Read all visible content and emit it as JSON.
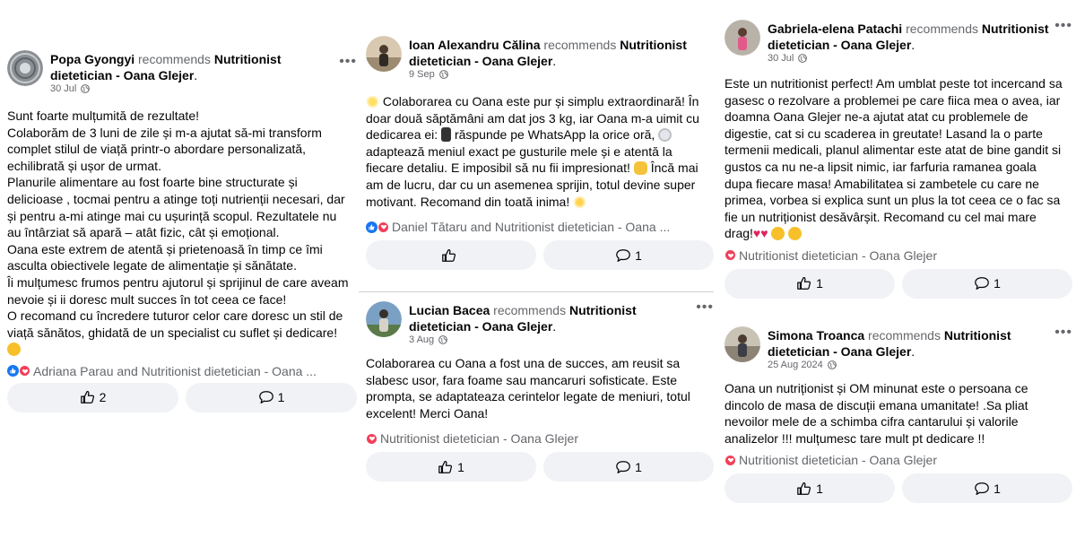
{
  "reviews": [
    {
      "author": "Popa Gyongyi",
      "recommends": "recommends",
      "page": "Nutritionist dietetician - Oana Glejer",
      "date": "30 Jul",
      "lines": [
        "Sunt foarte mulțumită de rezultate!",
        "Colaborăm de 3 luni de zile și m-a ajutat să-mi transform complet stilul de viață printr-o abordare personalizată, echilibrată și ușor de urmat.",
        "Planurile alimentare au fost foarte bine structurate și delicioase , tocmai pentru a atinge toți nutrienții necesari, dar și pentru a-mi atinge mai cu ușurință scopul.  Rezultatele nu au întârziat să apară – atât fizic, cât și emoțional.",
        "Oana este extrem de atentă și prietenoasă în timp ce îmi asculta obiectivele legate de alimentație și sănătate.",
        "Îi mulțumesc frumos pentru ajutorul și sprijinul de care aveam nevoie și ii doresc mult succes în tot ceea ce face!",
        "O recomand cu încredere tuturor celor care doresc un stil de viață sănătos, ghidată de un specialist cu suflet și dedicare!"
      ],
      "reactions_text": "Adriana Parau and Nutritionist dietetician - Oana ...",
      "like_count": "2",
      "comment_count": "1"
    },
    {
      "author": "Ioan Alexandru Călina",
      "recommends": "recommends",
      "page": "Nutritionist dietetician - Oana Glejer",
      "date": "9 Sep",
      "text_parts": [
        "Colaborarea cu Oana este pur și simplu extraordinară! În doar două săptămâni am dat jos 3 kg, iar Oana m-a uimit cu dedicarea ei: ",
        " răspunde pe WhatsApp la orice oră, ",
        " adaptează meniul exact pe gusturile mele și e atentă la fiecare detaliu. E imposibil să nu fii impresionat! ",
        " Încă mai am de lucru, dar cu un asemenea sprijin, totul devine super motivant. Recomand din toată inima! "
      ],
      "reactions_text": "Daniel Tătaru and Nutritionist dietetician - Oana ...",
      "like_count": "",
      "comment_count": "1"
    },
    {
      "author": "Lucian Bacea",
      "recommends": "recommends",
      "page": "Nutritionist dietetician - Oana Glejer",
      "date": "3 Aug",
      "text": "Colaborarea cu Oana a fost una de succes, am reusit sa slabesc usor, fara foame sau mancaruri sofisticate. Este prompta, se adaptateaza cerintelor legate de meniuri, totul excelent! Merci Oana!",
      "reactions_text": "Nutritionist dietetician - Oana Glejer",
      "like_count": "1",
      "comment_count": "1"
    },
    {
      "author": "Gabriela-elena Patachi",
      "recommends": "recommends",
      "page": "Nutritionist dietetician - Oana Glejer",
      "date": "30 Jul",
      "text": "Este un nutritionist perfect! Am umblat peste tot incercand sa gasesc o rezolvare a problemei pe care fiica mea o avea, iar doamna Oana Glejer ne-a ajutat atat cu problemele de digestie, cat si cu scaderea in greutate! Lasand la o parte termenii medicali, planul alimentar este atat de bine gandit si gustos ca nu ne-a lipsit nimic, iar farfuria ramanea goala dupa fiecare masa! Amabilitatea si zambetele cu care ne primea, vorbea si explica sunt un plus la tot ceea ce o fac sa fie un nutriționist desăvârșit. Recomand cu cel mai mare drag!",
      "reactions_text": "Nutritionist dietetician - Oana Glejer",
      "like_count": "1",
      "comment_count": "1"
    },
    {
      "author": "Simona Troanca",
      "recommends": "recommends",
      "page": "Nutritionist dietetician - Oana Glejer",
      "date": "25 Aug 2024",
      "text": "Oana un nutriționist și OM minunat este o persoana ce dincolo de masa de discuții emana umanitate! .Sa pliat nevoilor mele de a schimba cifra cantarului și valorile analizelor !!! mulțumesc tare mult pt dedicare !!",
      "reactions_text": "Nutritionist dietetician - Oana Glejer",
      "like_count": "1",
      "comment_count": "1"
    }
  ],
  "colors": {
    "like_blue": "#1877f2",
    "love_red": "#f33e58",
    "secondary_text": "#65676b",
    "button_bg": "#f0f2f5"
  },
  "icons": [
    "more-icon",
    "globe-icon",
    "like-icon",
    "comment-icon",
    "like-reaction-icon",
    "love-reaction-icon"
  ]
}
